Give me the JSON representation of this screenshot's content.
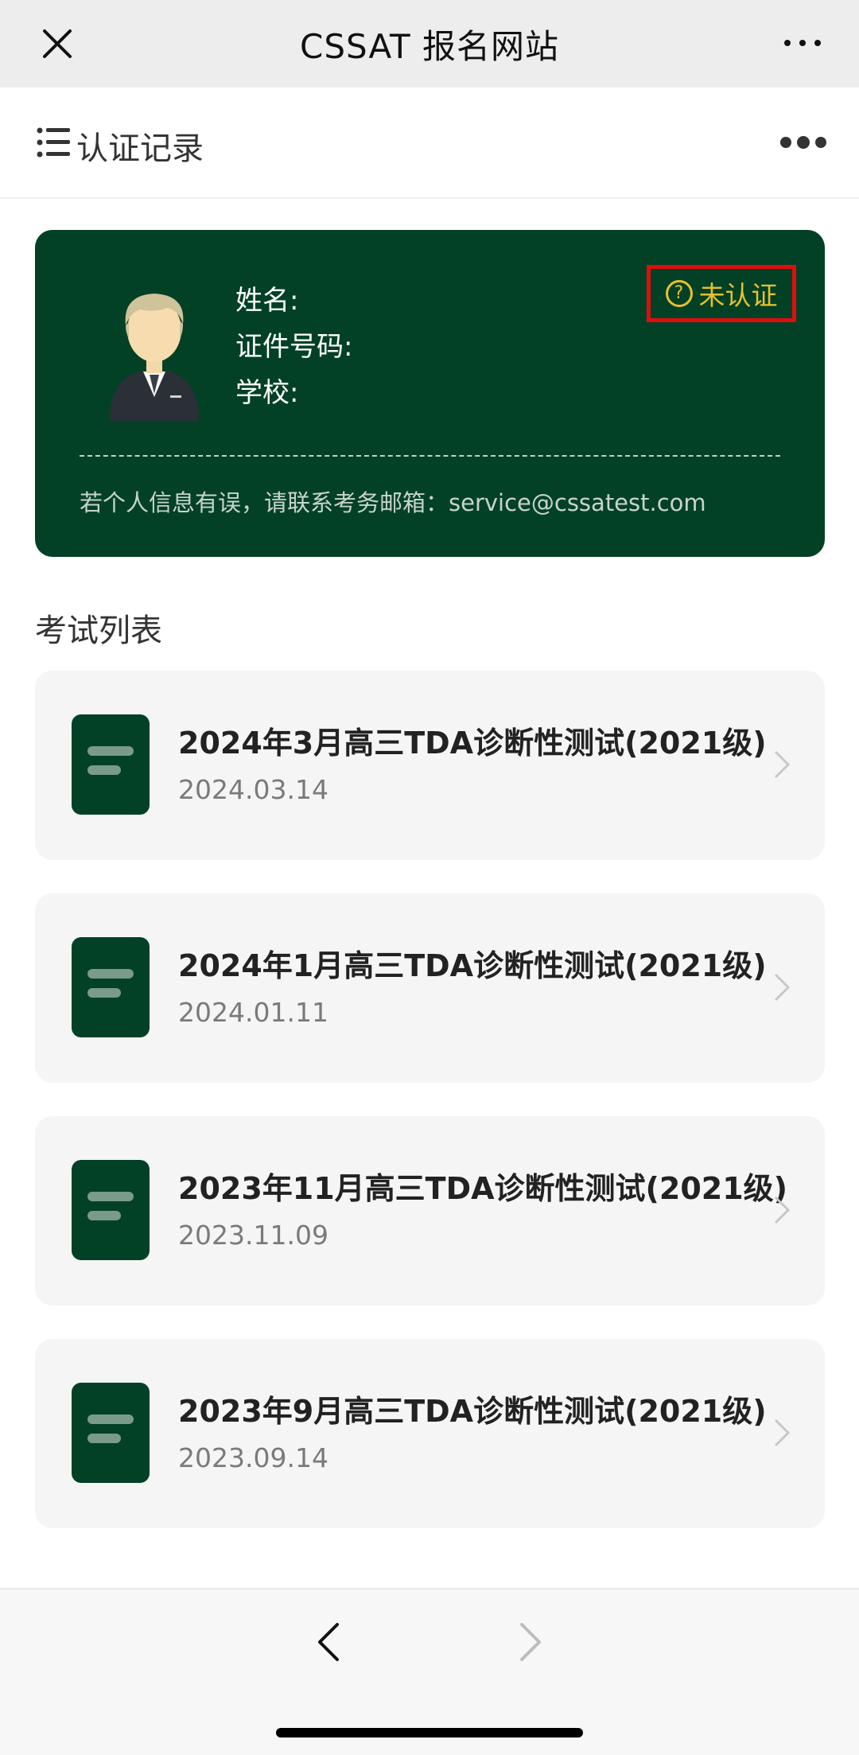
{
  "topbar": {
    "title": "CSSAT 报名网站",
    "close_icon": "close-icon",
    "more_icon": "more-horizontal-icon"
  },
  "subheader": {
    "label": "认证记录",
    "list_icon": "list-icon",
    "dots_icon": "more-dots-icon"
  },
  "profile": {
    "name_label": "姓名:",
    "id_label": "证件号码:",
    "school_label": "学校:",
    "status": "未认证",
    "status_icon": "question-circle-icon",
    "note": "若个人信息有误，请联系考务邮箱：service@cssatest.com",
    "card_color": "#034126",
    "status_color": "#e6c12e",
    "highlight_color": "#e00d0d"
  },
  "exams": {
    "section_title": "考试列表",
    "items": [
      {
        "name": "2024年3月高三TDA诊断性测试(2021级)",
        "date": "2024.03.14"
      },
      {
        "name": "2024年1月高三TDA诊断性测试(2021级)",
        "date": "2024.01.11"
      },
      {
        "name": "2023年11月高三TDA诊断性测试(2021级)",
        "date": "2023.11.09"
      },
      {
        "name": "2023年9月高三TDA诊断性测试(2021级)",
        "date": "2023.09.14"
      }
    ]
  },
  "bottombar": {
    "back_icon": "chevron-left-icon",
    "forward_icon": "chevron-right-icon"
  }
}
